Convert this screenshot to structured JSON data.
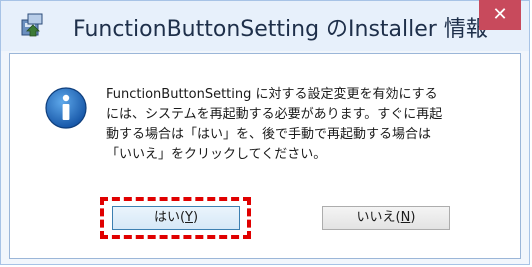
{
  "dialog": {
    "title": "FunctionButtonSetting のInstaller 情報",
    "close_glyph": "✕",
    "message": "FunctionButtonSetting に対する設定変更を有効にするには、システムを再起動する必要があります。すぐに再起動する場合は「はい」を、後で手動で再起動する場合は「いいえ」をクリックしてください。"
  },
  "buttons": {
    "yes": {
      "label": "はい(",
      "key": "Y",
      "suffix": ")"
    },
    "no": {
      "label": "いいえ(",
      "key": "N",
      "suffix": ")"
    }
  },
  "icons": {
    "app": "installer-package-icon",
    "info": "information-icon"
  },
  "colors": {
    "close_button": "#c84a5c",
    "highlight": "#e00000",
    "info_icon": "#1f6fc2"
  }
}
